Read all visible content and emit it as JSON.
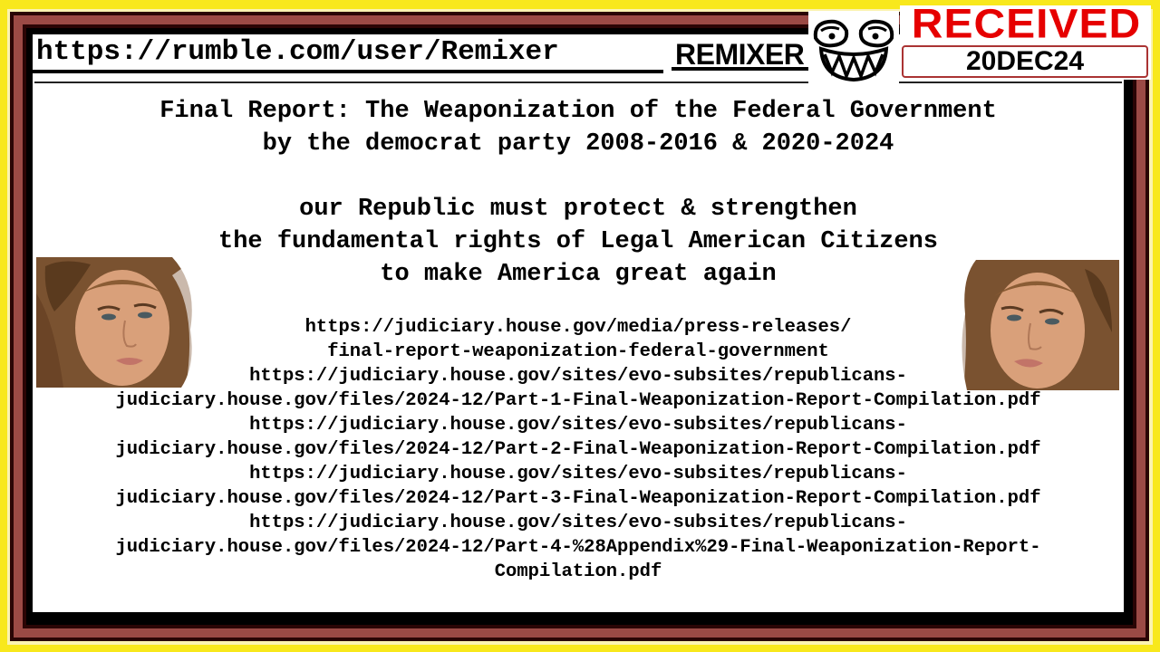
{
  "header": {
    "channel_url": "https://rumble.com/user/Remixer",
    "channel_name": "REMIXER",
    "mascot_icon": "grinning-monster-face-icon"
  },
  "stamp": {
    "label": "RECEIVED",
    "date": "20DEC24",
    "label_color": "#e60000"
  },
  "title": {
    "lines": [
      "Final Report: The Weaponization of the Federal Government",
      "by the democrat party 2008-2016 & 2020-2024"
    ]
  },
  "message": {
    "lines": [
      "our Republic must protect & strengthen",
      "the fundamental rights of Legal American Citizens",
      "to make America great again"
    ]
  },
  "links": {
    "lines": [
      "https://judiciary.house.gov/media/press-releases/",
      "final-report-weaponization-federal-government",
      "https://judiciary.house.gov/sites/evo-subsites/republicans-",
      "judiciary.house.gov/files/2024-12/Part-1-Final-Weaponization-Report-Compilation.pdf",
      "https://judiciary.house.gov/sites/evo-subsites/republicans-",
      "judiciary.house.gov/files/2024-12/Part-2-Final-Weaponization-Report-Compilation.pdf",
      "https://judiciary.house.gov/sites/evo-subsites/republicans-",
      "judiciary.house.gov/files/2024-12/Part-3-Final-Weaponization-Report-Compilation.pdf",
      "https://judiciary.house.gov/sites/evo-subsites/republicans-",
      "judiciary.house.gov/files/2024-12/Part-4-%28Appendix%29-Final-Weaponization-Report-",
      "Compilation.pdf"
    ]
  },
  "portraits": {
    "left": "woman-portrait-left",
    "right": "woman-portrait-right"
  },
  "colors": {
    "outer_background": "#f8e81c",
    "frame_red": "#9b4a45",
    "frame_dark": "#2a0505"
  }
}
